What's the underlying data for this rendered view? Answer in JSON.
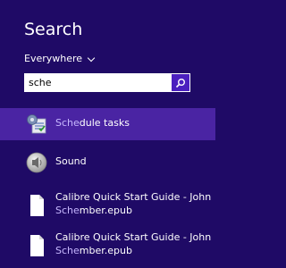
{
  "header": {
    "title": "Search"
  },
  "scope": {
    "label": "Everywhere"
  },
  "search": {
    "value": "sche",
    "icon": "search-icon"
  },
  "results": [
    {
      "name": "Schedule tasks",
      "match": "Sche",
      "rest": "dule tasks",
      "icon": "schedule-tasks-icon",
      "selected": true
    },
    {
      "name": "Sound",
      "match": "",
      "rest": "Sound",
      "icon": "speaker-icon",
      "selected": false
    },
    {
      "line1": "Calibre Quick Start Guide - John",
      "line2_match": "Sche",
      "line2_rest": "mber.epub",
      "icon": "document-icon"
    },
    {
      "line1": "Calibre Quick Start Guide - John",
      "line2_match": "Sche",
      "line2_rest": "mber.epub",
      "icon": "document-icon"
    }
  ],
  "colors": {
    "background": "#1f0a66",
    "selected": "#4a24a3",
    "search_button": "#4b1fbf"
  }
}
